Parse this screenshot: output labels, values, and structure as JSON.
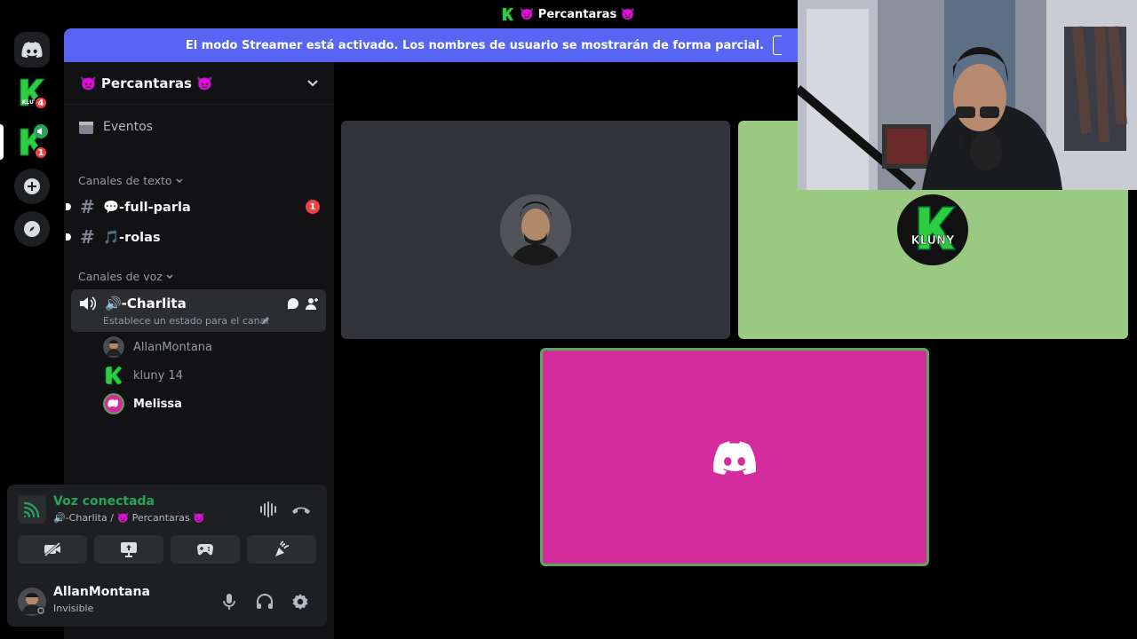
{
  "window": {
    "title": "👿 Percantaras 👿"
  },
  "rail": {
    "servers": [
      {
        "name": "kluny-server",
        "badge": "4"
      },
      {
        "name": "kluny-server-voice",
        "badge": "1"
      }
    ]
  },
  "banner": {
    "text": "El modo Streamer está activado. Los nombres de usuario se mostrarán de forma parcial."
  },
  "guild": {
    "name": "👿 Percantaras 👿"
  },
  "sidebar": {
    "events_label": "Eventos",
    "text_category": "Canales de texto",
    "text_channels": [
      {
        "name": "💬-full-parla",
        "mentions": "1"
      },
      {
        "name": "🎵-rolas",
        "mentions": ""
      }
    ],
    "voice_category": "Canales de voz",
    "voice_channel": {
      "name": "🔊-Charlita",
      "status_placeholder": "Establece un estado para el canal"
    },
    "voice_members": [
      {
        "name": "AllanMontana",
        "speaking": false
      },
      {
        "name": "kluny 14",
        "speaking": false
      },
      {
        "name": "Melissa",
        "speaking": true
      }
    ]
  },
  "rtc": {
    "title": "Voz conectada",
    "subtitle": "🔊-Charlita / 👿 Percantaras 👿"
  },
  "user": {
    "name": "AllanMontana",
    "status": "Invisible"
  },
  "stage": {
    "tiles": [
      {
        "user": "AllanMontana",
        "color": "#313338"
      },
      {
        "user": "kluny 14",
        "color": "#9ac982",
        "logo_text": "KLUNY"
      },
      {
        "user": "Melissa",
        "color": "#d42c9c",
        "speaking": true
      }
    ]
  },
  "colors": {
    "brand": "#5865f2",
    "connected": "#23a55a",
    "mention": "#f23f42",
    "speaking_ring": "#58a95c"
  }
}
